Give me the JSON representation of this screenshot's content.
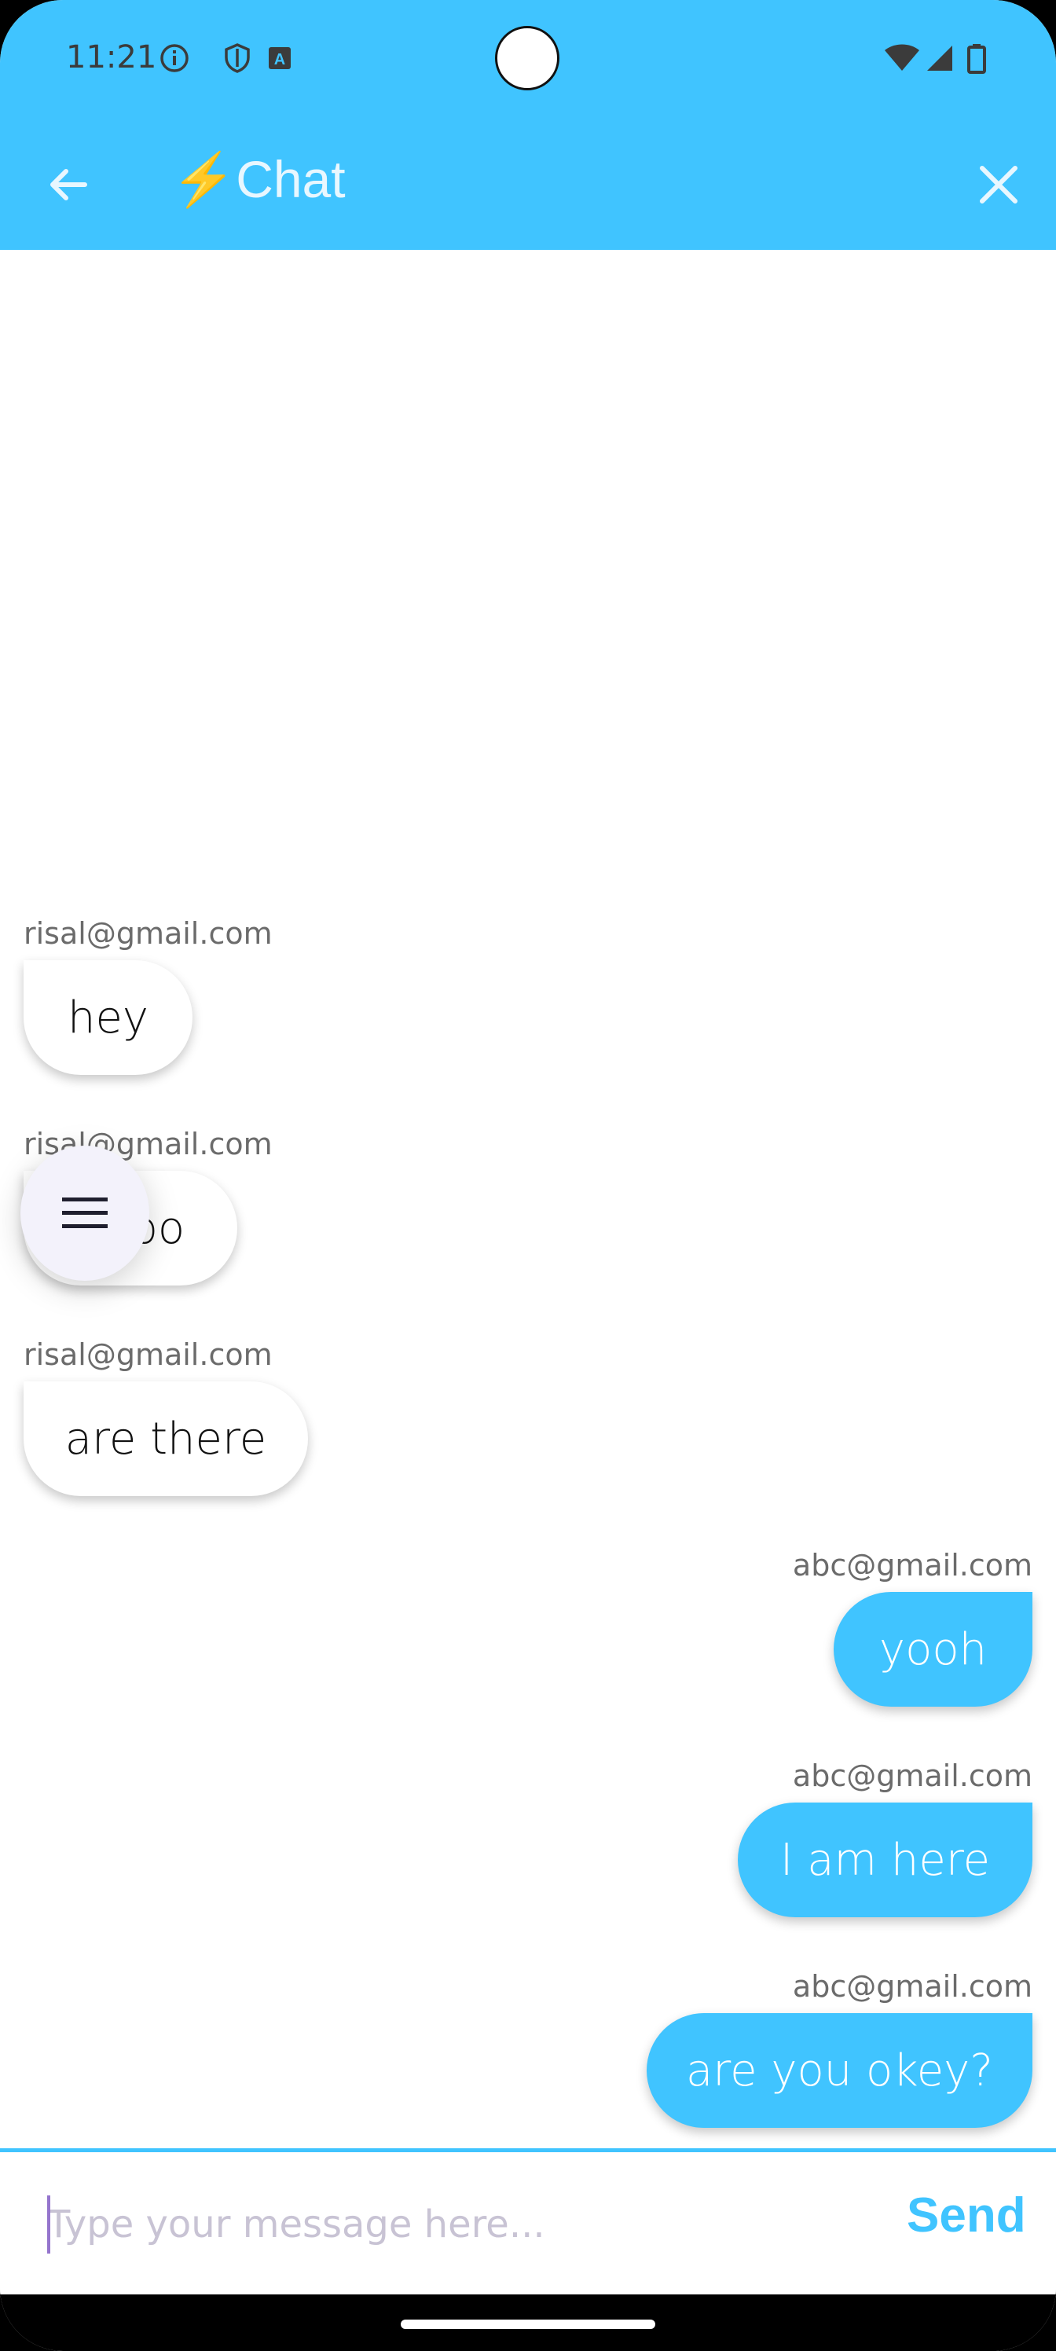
{
  "status_bar": {
    "time": "11:21",
    "icons": [
      "info-icon",
      "shield-icon",
      "translate-icon",
      "wifi-icon",
      "signal-icon",
      "battery-icon"
    ]
  },
  "app_bar": {
    "title_emoji": "⚡",
    "title": "Chat",
    "color": "#40C4FF"
  },
  "messages": [
    {
      "sender": "risal@gmail.com",
      "text": "hey",
      "direction": "incoming"
    },
    {
      "sender": "risal@gmail.com",
      "text": "hooo",
      "direction": "incoming"
    },
    {
      "sender": "risal@gmail.com",
      "text": "are there",
      "direction": "incoming"
    },
    {
      "sender": "abc@gmail.com",
      "text": "yooh",
      "direction": "outgoing"
    },
    {
      "sender": "abc@gmail.com",
      "text": "I am here",
      "direction": "outgoing"
    },
    {
      "sender": "abc@gmail.com",
      "text": "are you okey?",
      "direction": "outgoing"
    }
  ],
  "fab": {
    "icon": "menu-icon"
  },
  "composer": {
    "placeholder": "Type your message here...",
    "value": "",
    "send_label": "Send"
  },
  "colors": {
    "accent": "#40C4FF",
    "incoming_bubble": "#FFFFFF",
    "outgoing_bubble": "#40C4FF",
    "caret": "#9575CD"
  }
}
